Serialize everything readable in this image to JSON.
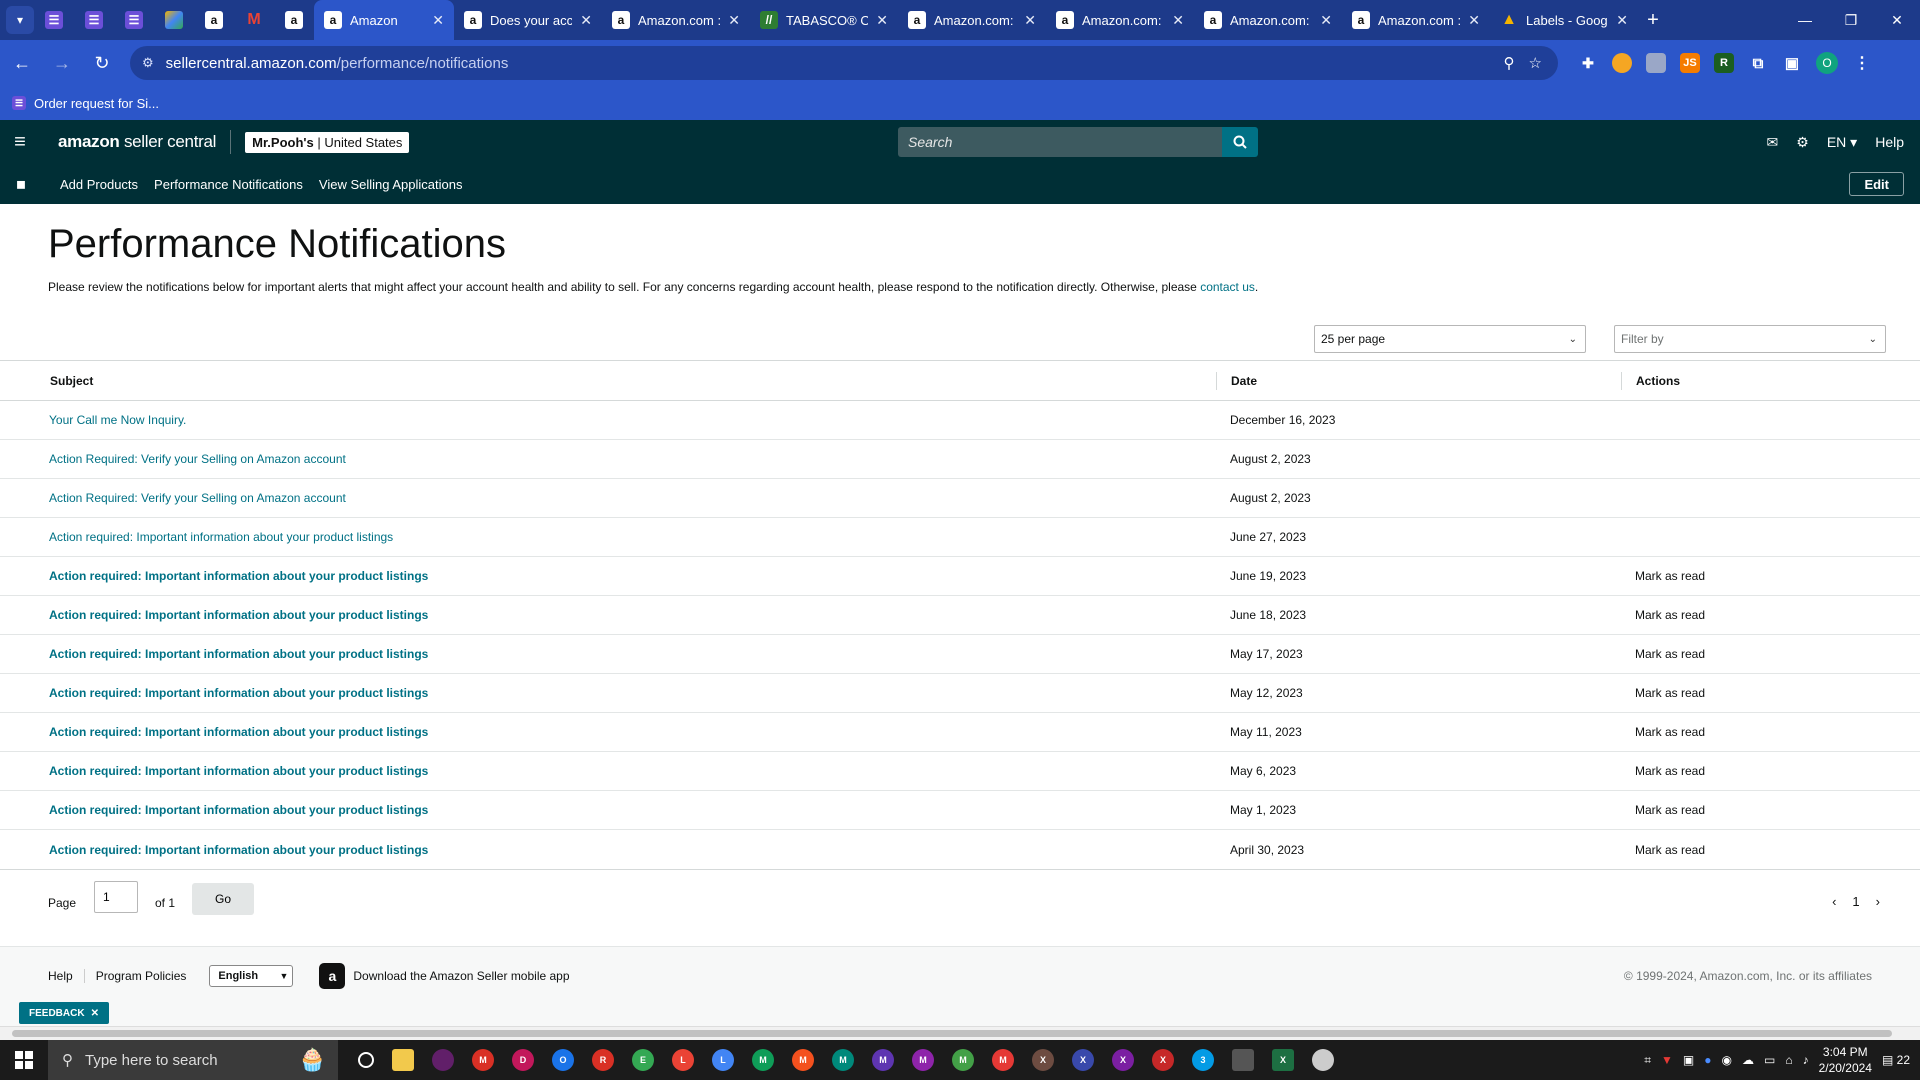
{
  "browser": {
    "tabs": [
      {
        "title": "Amazon",
        "icon": "amazon-icon",
        "active": true
      },
      {
        "title": "Does your acc",
        "icon": "amazon-icon"
      },
      {
        "title": "Amazon.com :",
        "icon": "amazon-icon"
      },
      {
        "title": "TABASCO® Or",
        "icon": "tabasco-icon"
      },
      {
        "title": "Amazon.com: \\",
        "icon": "amazon-icon"
      },
      {
        "title": "Amazon.com:",
        "icon": "amazon-icon"
      },
      {
        "title": "Amazon.com: I",
        "icon": "amazon-icon"
      },
      {
        "title": "Amazon.com :",
        "icon": "amazon-icon"
      },
      {
        "title": "Labels - Googl",
        "icon": "drive-icon"
      }
    ],
    "url_host": "sellercentral.amazon.com",
    "url_path": "/performance/notifications",
    "bookmark": "Order request for Si...",
    "profile_initial": "O"
  },
  "header": {
    "logo_brand": "amazon",
    "logo_product": "seller central",
    "store_name": "Mr.Pooh's",
    "store_region": "United States",
    "search_placeholder": "Search",
    "lang": "EN",
    "help": "Help"
  },
  "subnav": {
    "links": [
      "Add Products",
      "Performance Notifications",
      "View Selling Applications"
    ],
    "edit": "Edit"
  },
  "page": {
    "title": "Performance Notifications",
    "intro": "Please review the notifications below for important alerts that might affect your account health and ability to sell. For any concerns regarding account health, please respond to the notification directly. Otherwise, please ",
    "intro_link": "contact us",
    "intro_end": ".",
    "per_page": "25 per page",
    "filter_placeholder": "Filter by"
  },
  "table": {
    "headers": {
      "subject": "Subject",
      "date": "Date",
      "actions": "Actions"
    },
    "rows": [
      {
        "subject": "Your Call me Now Inquiry.",
        "date": "December 16, 2023",
        "action": "",
        "unread": false
      },
      {
        "subject": "Action Required: Verify your Selling on Amazon account",
        "date": "August 2, 2023",
        "action": "",
        "unread": false
      },
      {
        "subject": "Action Required: Verify your Selling on Amazon account",
        "date": "August 2, 2023",
        "action": "",
        "unread": false
      },
      {
        "subject": "Action required: Important information about your product listings",
        "date": "June 27, 2023",
        "action": "",
        "unread": false
      },
      {
        "subject": "Action required: Important information about your product listings",
        "date": "June 19, 2023",
        "action": "Mark as read",
        "unread": true
      },
      {
        "subject": "Action required: Important information about your product listings",
        "date": "June 18, 2023",
        "action": "Mark as read",
        "unread": true
      },
      {
        "subject": "Action required: Important information about your product listings",
        "date": "May 17, 2023",
        "action": "Mark as read",
        "unread": true
      },
      {
        "subject": "Action required: Important information about your product listings",
        "date": "May 12, 2023",
        "action": "Mark as read",
        "unread": true
      },
      {
        "subject": "Action required: Important information about your product listings",
        "date": "May 11, 2023",
        "action": "Mark as read",
        "unread": true
      },
      {
        "subject": "Action required: Important information about your product listings",
        "date": "May 6, 2023",
        "action": "Mark as read",
        "unread": true
      },
      {
        "subject": "Action required: Important information about your product listings",
        "date": "May 1, 2023",
        "action": "Mark as read",
        "unread": true
      },
      {
        "subject": "Action required: Important information about your product listings",
        "date": "April 30, 2023",
        "action": "Mark as read",
        "unread": true
      }
    ]
  },
  "pager": {
    "page_label": "Page",
    "page_value": "1",
    "of_label": "of 1",
    "go": "Go",
    "current": "1"
  },
  "footer": {
    "help": "Help",
    "policies": "Program Policies",
    "language": "English",
    "app_text": "Download the Amazon Seller mobile app",
    "copyright": "© 1999-2024, Amazon.com, Inc. or its affiliates",
    "feedback": "FEEDBACK"
  },
  "taskbar": {
    "search_placeholder": "Type here to search",
    "time": "3:04 PM",
    "date": "2/20/2024",
    "notifications": "22"
  },
  "colors": {
    "header_bg": "#002f36",
    "link": "#007185",
    "browser_tab_bar": "#1d3a8a",
    "browser_toolbar": "#2c56c9"
  }
}
